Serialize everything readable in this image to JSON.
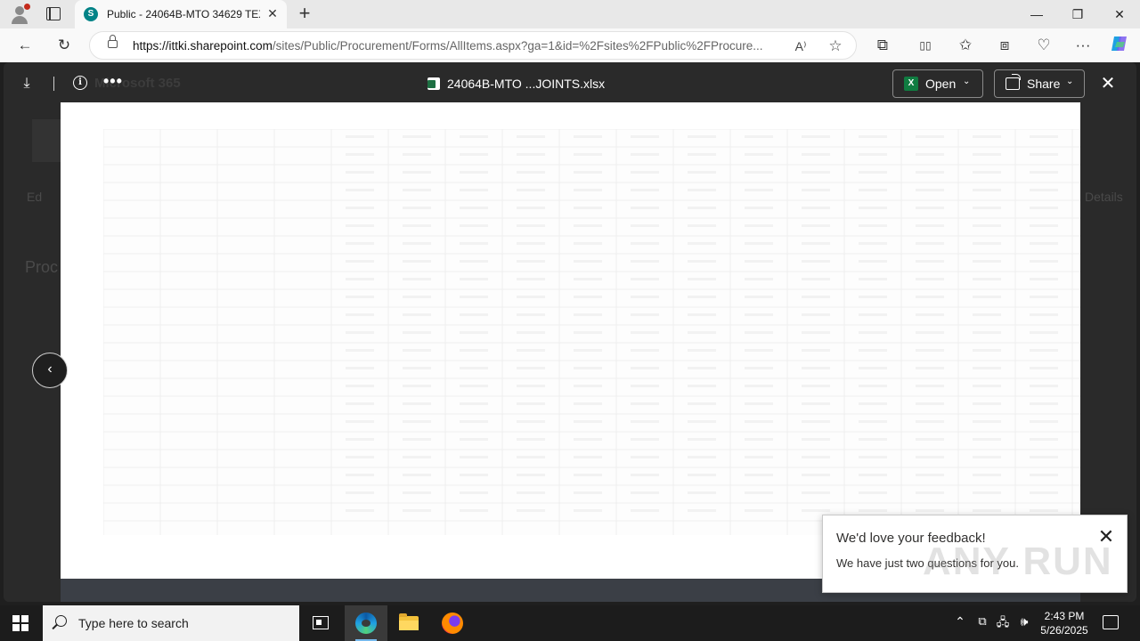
{
  "browser": {
    "tab": {
      "favicon_letter": "S",
      "title": "Public - 24064B-MTO 34629 TEXT...",
      "close_glyph": "✕"
    },
    "new_tab_glyph": "+",
    "window_controls": {
      "minimize": "—",
      "restore": "❐",
      "close": "✕"
    },
    "toolbar": {
      "back": "←",
      "refresh": "↻"
    },
    "address": {
      "host": "https://ittki.sharepoint.com",
      "path": "/sites/Public/Procurement/Forms/AllItems.aspx?ga=1&id=%2Fsites%2FPublic%2FProcure..."
    },
    "url_icons": {
      "read_aloud": "A⁾",
      "favorite": "☆"
    },
    "right_icons": {
      "extensions": "⧉",
      "split": "▯▯",
      "favorites": "✩",
      "collections": "⧈",
      "performance": "♡",
      "more": "···"
    }
  },
  "viewer": {
    "download_glyph": "⤓",
    "info_glyph": "i",
    "brand_ghost": "Microsoft 365",
    "more_glyph": "•••",
    "file_name": "24064B-MTO ...JOINTS.xlsx",
    "open_label": "Open",
    "share_label": "Share",
    "chev": "⌄",
    "close_glyph": "✕",
    "prev_glyph": "‹"
  },
  "background_ghost": {
    "procurement": "Proc",
    "edit": "Ed",
    "details": "Details"
  },
  "feedback": {
    "title": "We'd love your feedback!",
    "subtitle": "We have just two questions for you.",
    "close_glyph": "✕"
  },
  "watermark": "ANY RUN",
  "taskbar": {
    "search_placeholder": "Type here to search",
    "tray": {
      "up": "⌃",
      "network": "🖧",
      "volume": "🕪"
    },
    "time": "2:43 PM",
    "date": "5/26/2025"
  },
  "colors": {
    "excel_green": "#107c41",
    "sharepoint_teal": "#038387",
    "edge_blue": "#1fa0e3"
  }
}
